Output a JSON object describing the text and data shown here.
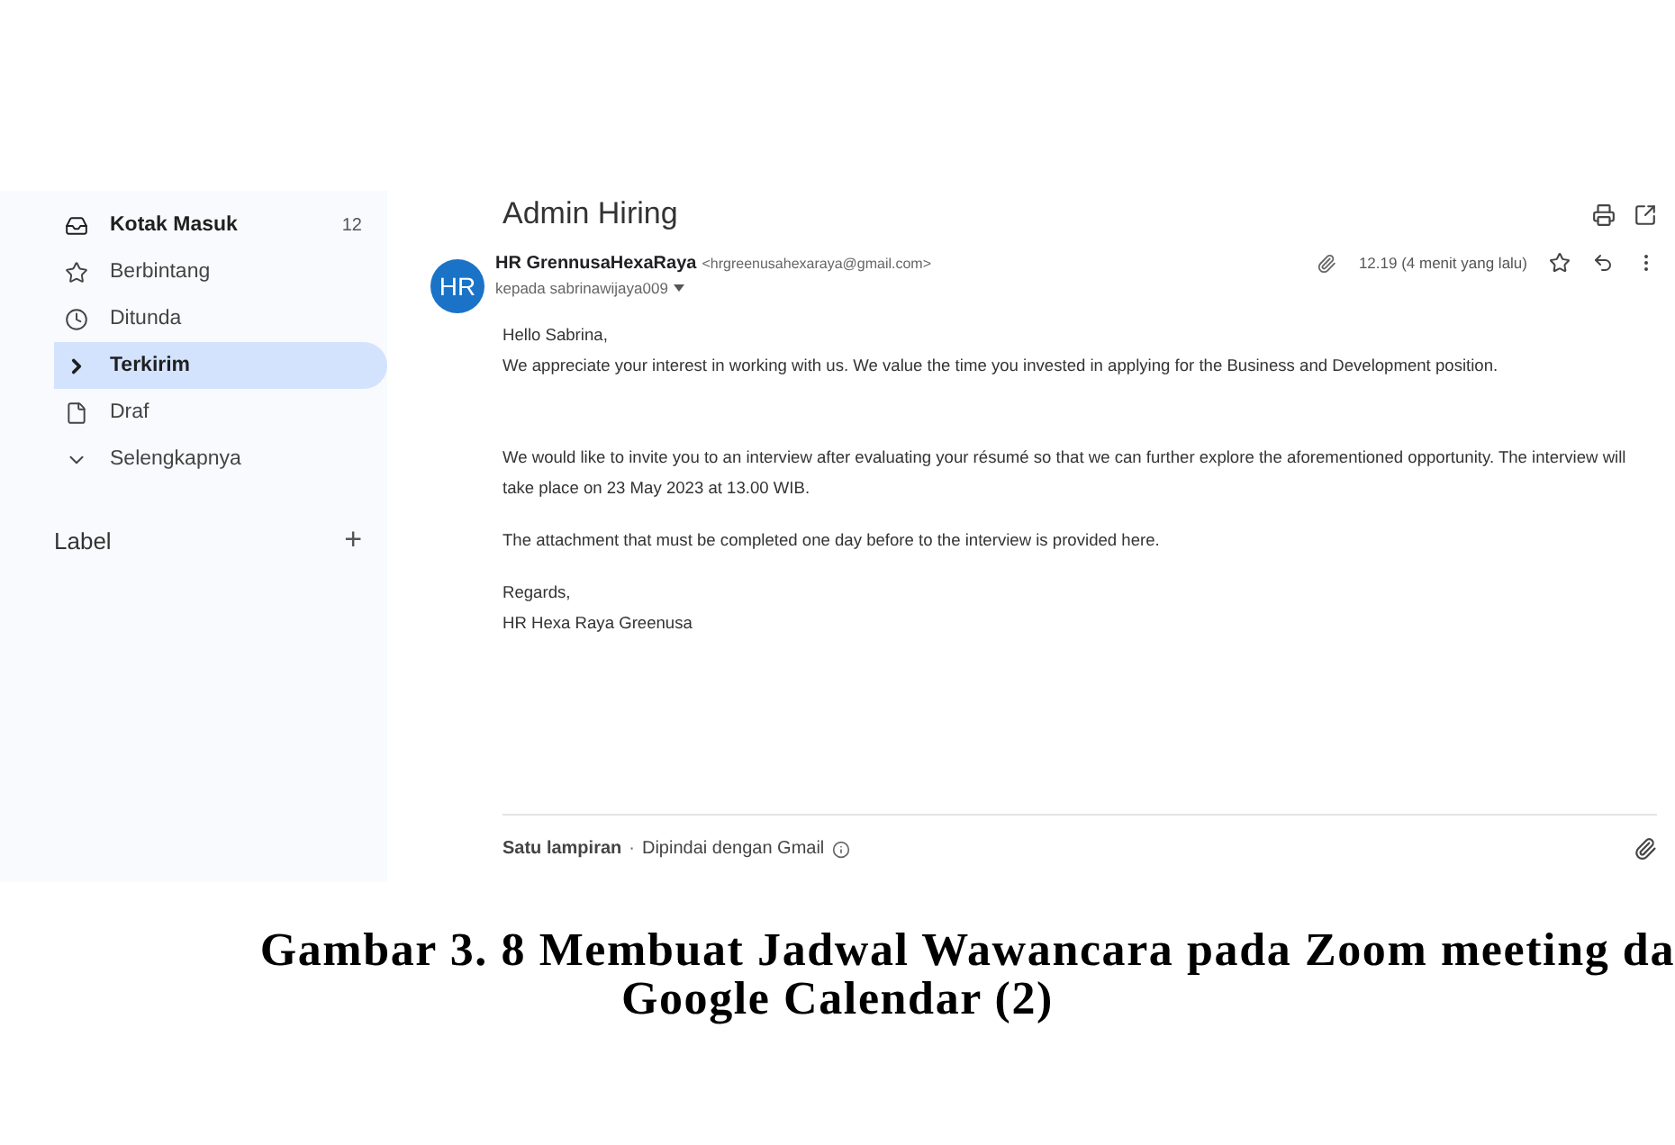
{
  "sidebar": {
    "items": [
      {
        "label": "Kotak Masuk",
        "count": "12",
        "bold": true,
        "selected": false
      },
      {
        "label": "Berbintang",
        "bold": false,
        "selected": false
      },
      {
        "label": "Ditunda",
        "bold": false,
        "selected": false
      },
      {
        "label": "Terkirim",
        "bold": true,
        "selected": true
      },
      {
        "label": "Draf",
        "bold": false,
        "selected": false
      },
      {
        "label": "Selengkapnya",
        "bold": false,
        "selected": false
      }
    ],
    "label_heading": "Label",
    "add": "+"
  },
  "email": {
    "subject": "Admin Hiring",
    "avatar": "HR",
    "sender_name": "HR GrennusaHexaRaya",
    "sender_email": "<hrgreenusahexaraya@gmail.com>",
    "recipient": "kepada sabrinawijaya009",
    "time": "12.19 (4 menit yang lalu)",
    "body": [
      "Hello Sabrina,",
      "We appreciate your interest in working with us. We value the time you invested in applying for the Business and Development position.",
      "We would like to invite you to an interview after evaluating your résumé so that we can further explore the aforementioned opportunity. The interview will take place on 23 May 2023 at 13.00 WIB.",
      "The attachment that must be completed one day before to the interview is provided here.",
      "Regards,\nHR Hexa Raya Greenusa"
    ],
    "attachment": {
      "title": "Satu lampiran",
      "separator": "·",
      "note": "Dipindai dengan Gmail"
    }
  },
  "caption": {
    "lines": [
      "Gambar 3. 8 Membuat Jadwal Wawancara pada Zoom meeting da",
      "Google Calendar (2)"
    ]
  }
}
